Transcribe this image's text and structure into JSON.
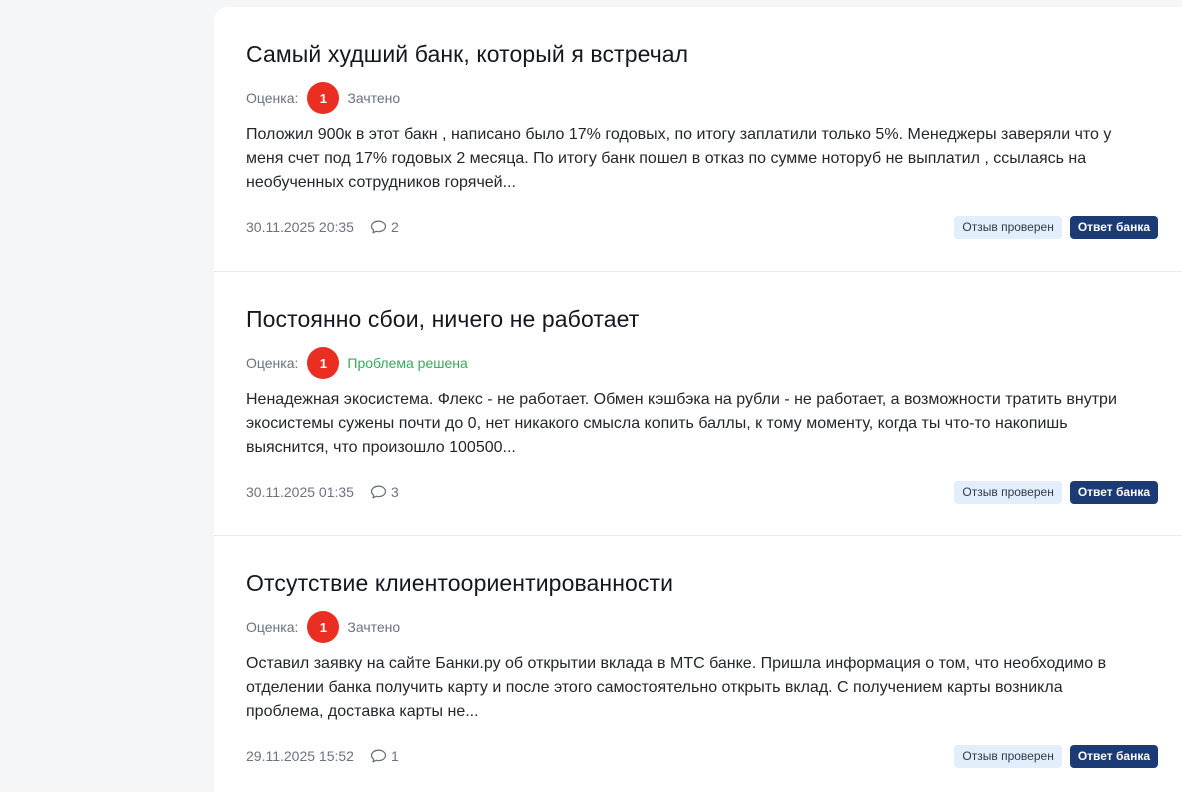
{
  "reviews": [
    {
      "title": "Самый худший банк, который я встречал",
      "rating_label": "Оценка:",
      "rating": "1",
      "status": "Зачтено",
      "text": "Положил 900к в этот бакн , написано было 17% годовых, по итогу заплатили только 5%. Менеджеры заверяли что у меня счет под 17% годовых 2 месяца. По итогу банк пошел в отказ по сумме ноторуб не выплатил , ссылаясь на необученных сотрудников горячей...",
      "date": "30.11.2025 20:35",
      "comments": "2",
      "tag_verified": "Отзыв проверен",
      "tag_answer": "Ответ банка"
    },
    {
      "title": "Постоянно сбои, ничего не работает",
      "rating_label": "Оценка:",
      "rating": "1",
      "status": "Проблема решена",
      "text": "Ненадежная экосистема. Флекс - не работает. Обмен кэшбэка на рубли - не работает, а возможности тратить внутри экосистемы сужены почти до 0, нет никакого смысла копить баллы, к тому моменту, когда ты что-то накопишь выяснится, что произошло 100500...",
      "date": "30.11.2025 01:35",
      "comments": "3",
      "tag_verified": "Отзыв проверен",
      "tag_answer": "Ответ банка"
    },
    {
      "title": "Отсутствие клиентоориентированности",
      "rating_label": "Оценка:",
      "rating": "1",
      "status": "Зачтено",
      "text": "Оставил заявку на сайте Банки.ру об открытии вклада в МТС банке. Пришла информация о том, что необходимо в отделении банка получить карту и после этого самостоятельно открыть вклад. С получением карты возникла проблема, доставка карты не...",
      "date": "29.11.2025 15:52",
      "comments": "1",
      "tag_verified": "Отзыв проверен",
      "tag_answer": "Ответ банка"
    }
  ],
  "colors": {
    "rating_badge": "#ea2e22",
    "status_solved": "#37a95a",
    "tag_verified_bg": "#e2eefb",
    "tag_answer_bg": "#1c3b74"
  },
  "icons": {
    "comments": "speech-bubble-icon"
  }
}
